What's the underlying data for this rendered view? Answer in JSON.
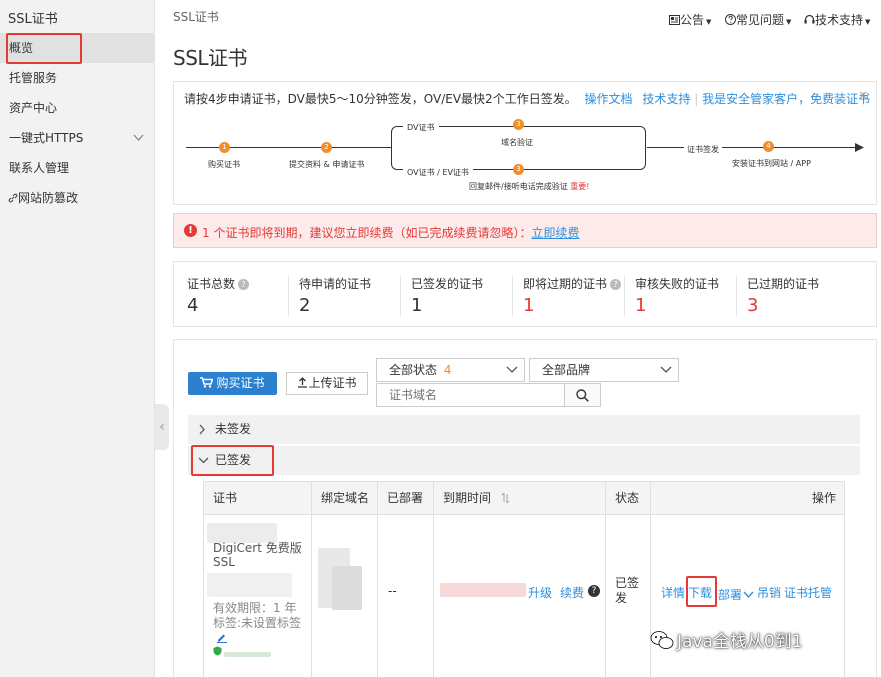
{
  "sidebar": {
    "title": "SSL证书",
    "items": [
      {
        "label": "概览"
      },
      {
        "label": "托管服务"
      },
      {
        "label": "资产中心"
      },
      {
        "label": "一键式HTTPS"
      },
      {
        "label": "联系人管理"
      },
      {
        "label": "网站防篡改"
      }
    ]
  },
  "header": {
    "breadcrumb": "SSL证书",
    "announcements": "公告",
    "faq": "常见问题",
    "support": "技术支持",
    "page_title": "SSL证书"
  },
  "steps": {
    "intro": "请按4步申请证书，DV最快5～10分钟签发，OV/EV最快2个工作日签发。",
    "link_docs": "操作文档",
    "link_support": "技术支持",
    "separator": "|",
    "link_security": "我是安全管家客户，免费装证书",
    "close": "×",
    "step1": "购买证书",
    "step2": "提交资料 & 申请证书",
    "dv_label": "DV证书",
    "domain_verify": "域名验证",
    "ovev_label": "OV证书 / EV证书",
    "callback_verify": "回复邮件/接听电话完成验证",
    "important": "重要!",
    "cert_issue": "证书签发",
    "step4": "安装证书到网站 / APP",
    "n1": "1",
    "n2": "2",
    "n3a": "3",
    "n3b": "3",
    "n4": "4"
  },
  "alert": {
    "icon": "!",
    "text": "1 个证书即将到期，建议您立即续费（如已完成续费请忽略）：",
    "link": "立即续费"
  },
  "stats": [
    {
      "label": "证书总数",
      "value": "4",
      "help": "?"
    },
    {
      "label": "待申请的证书",
      "value": "2"
    },
    {
      "label": "已签发的证书",
      "value": "1"
    },
    {
      "label": "即将过期的证书",
      "value": "1",
      "help": "?"
    },
    {
      "label": "审核失败的证书",
      "value": "1"
    },
    {
      "label": "已过期的证书",
      "value": "3"
    }
  ],
  "toolbar": {
    "buy": "购买证书",
    "upload": "上传证书",
    "status_select": "全部状态",
    "status_count": "4",
    "brand_select": "全部品牌",
    "search_placeholder": "证书域名"
  },
  "groups": {
    "unissued": "未签发",
    "issued": "已签发"
  },
  "table": {
    "headers": [
      "证书",
      "绑定域名",
      "已部署",
      "到期时间",
      "状态",
      "操作"
    ],
    "row": {
      "cert_name": "DigiCert 免费版 SSL",
      "validity": "有效期限：1 年",
      "tag": "标签:未设置标签",
      "deployed": "--",
      "upgrade": "升级",
      "renew": "续费",
      "help": "?",
      "status": "已签发",
      "ops": {
        "detail": "详情",
        "download": "下载",
        "deploy": "部署",
        "revoke": "吊销",
        "hosting": "证书托管"
      }
    }
  },
  "watermark": "Java全栈从0到1",
  "colors": {
    "accent": "#2c8fde",
    "primary_button": "#2c80d0",
    "alert_red": "#e53935",
    "step_orange": "#f08f2a"
  }
}
